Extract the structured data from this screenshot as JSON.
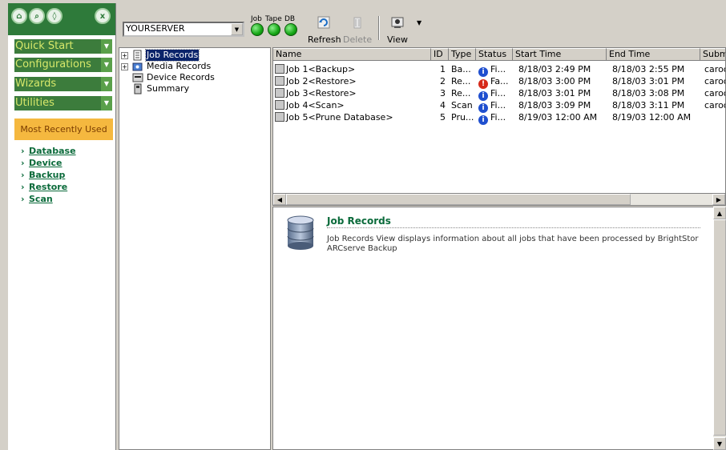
{
  "nav": {
    "sections": [
      "Quick Start",
      "Configurations",
      "Wizards",
      "Utilities"
    ],
    "mru_title": "Most Recently Used",
    "mru_links": [
      "Database",
      "Device",
      "Backup",
      "Restore",
      "Scan"
    ],
    "close_glyph": "x"
  },
  "toolbar": {
    "server": "YOURSERVER",
    "led_labels": [
      "Job",
      "Tape",
      "DB"
    ],
    "refresh": "Refresh",
    "delete": "Delete",
    "view": "View"
  },
  "tree": {
    "items": [
      {
        "label": "Job Records",
        "expandable": true,
        "selected": true,
        "icon": "job-records-icon"
      },
      {
        "label": "Media Records",
        "expandable": true,
        "selected": false,
        "icon": "media-records-icon"
      },
      {
        "label": "Device Records",
        "expandable": false,
        "selected": false,
        "icon": "device-records-icon"
      },
      {
        "label": "Summary",
        "expandable": false,
        "selected": false,
        "icon": "summary-icon"
      }
    ]
  },
  "list": {
    "columns": [
      "Name",
      "ID",
      "Type",
      "Status",
      "Start Time",
      "End Time",
      "Submit"
    ],
    "rows": [
      {
        "name": "Job 1<Backup>",
        "id": "1",
        "type": "Ba...",
        "status": "Fi...",
        "status_kind": "info",
        "start": "8/18/03 2:49 PM",
        "end": "8/18/03 2:55 PM",
        "submit": "caroot"
      },
      {
        "name": "Job 2<Restore>",
        "id": "2",
        "type": "Re...",
        "status": "Fa...",
        "status_kind": "error",
        "start": "8/18/03 3:00 PM",
        "end": "8/18/03 3:01 PM",
        "submit": "caroot"
      },
      {
        "name": "Job 3<Restore>",
        "id": "3",
        "type": "Re...",
        "status": "Fi...",
        "status_kind": "info",
        "start": "8/18/03 3:01 PM",
        "end": "8/18/03 3:08 PM",
        "submit": "caroot"
      },
      {
        "name": "Job 4<Scan>",
        "id": "4",
        "type": "Scan",
        "status": "Fi...",
        "status_kind": "info",
        "start": "8/18/03 3:09 PM",
        "end": "8/18/03 3:11 PM",
        "submit": "caroot"
      },
      {
        "name": "Job 5<Prune Database>",
        "id": "5",
        "type": "Pru...",
        "status": "Fi...",
        "status_kind": "info",
        "start": "8/19/03 12:00 AM",
        "end": "8/19/03 12:00 AM",
        "submit": ""
      }
    ]
  },
  "detail": {
    "title": "Job Records",
    "description": "Job Records View displays information about all jobs that have been processed by BrightStor ARCserve Backup"
  },
  "colors": {
    "nav_dark": "#2e7a3a",
    "nav_section": "#3c7c3c",
    "nav_section_text": "#d7e86a",
    "mru_bg": "#f5b83f",
    "link_green": "#0a6a3a",
    "info_blue": "#1f4fcf",
    "error_red": "#d62a1a",
    "led_green": "#14a514"
  }
}
